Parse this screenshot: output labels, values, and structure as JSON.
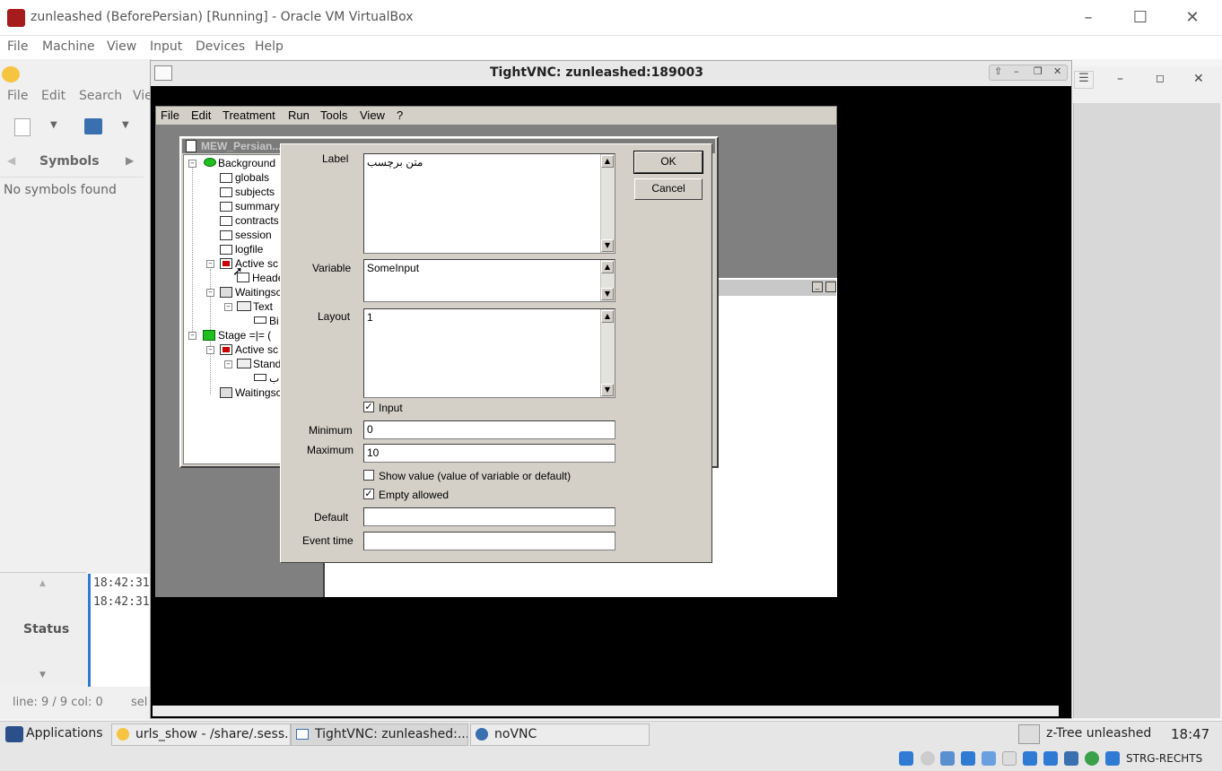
{
  "vbox": {
    "title": "zunleashed (BeforePersian) [Running] - Oracle VM VirtualBox",
    "menu": [
      "File",
      "Machine",
      "View",
      "Input",
      "Devices",
      "Help"
    ]
  },
  "editor": {
    "menu": [
      "File",
      "Edit",
      "Search",
      "Vie"
    ],
    "symbols_tab": "Symbols",
    "no_symbols": "No symbols found",
    "status_label": "Status",
    "log": [
      "18:42:31:",
      "18:42:31:"
    ],
    "line_col": "line: 9 / 9  col: 0",
    "sel": "sel"
  },
  "vnc": {
    "title": "TightVNC: zunleashed:189003"
  },
  "ztree": {
    "menu": [
      "File",
      "Edit",
      "Treatment",
      "Run",
      "Tools",
      "View",
      "?"
    ],
    "treewin_title": "MEW_Persian...",
    "tree": [
      {
        "label": "Background"
      },
      {
        "label": "globals"
      },
      {
        "label": "subjects"
      },
      {
        "label": "summary"
      },
      {
        "label": "contracts"
      },
      {
        "label": "session"
      },
      {
        "label": "logfile"
      },
      {
        "label": "Active sc"
      },
      {
        "label": "Heade"
      },
      {
        "label": "Waitingsc"
      },
      {
        "label": "Text"
      },
      {
        "label": "Bi"
      },
      {
        "label": "Stage =|= ("
      },
      {
        "label": "Active sc"
      },
      {
        "label": "Stand"
      },
      {
        "label": "ب"
      },
      {
        "label": "Waitingsc"
      }
    ]
  },
  "dialog": {
    "label_label": "Label",
    "label_value": "متن برچسب",
    "variable_label": "Variable",
    "variable_value": "SomeInput",
    "layout_label": "Layout",
    "layout_value": "1",
    "input_label": "Input",
    "input_checked": true,
    "minimum_label": "Minimum",
    "minimum_value": "0",
    "maximum_label": "Maximum",
    "maximum_value": "10",
    "show_value_label": "Show value (value of variable or default)",
    "show_value_checked": false,
    "empty_allowed_label": "Empty allowed",
    "empty_allowed_checked": true,
    "default_label": "Default",
    "default_value": "",
    "event_time_label": "Event time",
    "event_time_value": "",
    "ok_label": "OK",
    "cancel_label": "Cancel"
  },
  "taskbar": {
    "applications": "Applications",
    "tasks": [
      "urls_show - /share/.sess...",
      "TightVNC: zunleashed:...",
      "noVNC"
    ],
    "ztree_label": "z-Tree unleashed",
    "clock": "18:47",
    "keyboard": "STRG-RECHTS"
  }
}
